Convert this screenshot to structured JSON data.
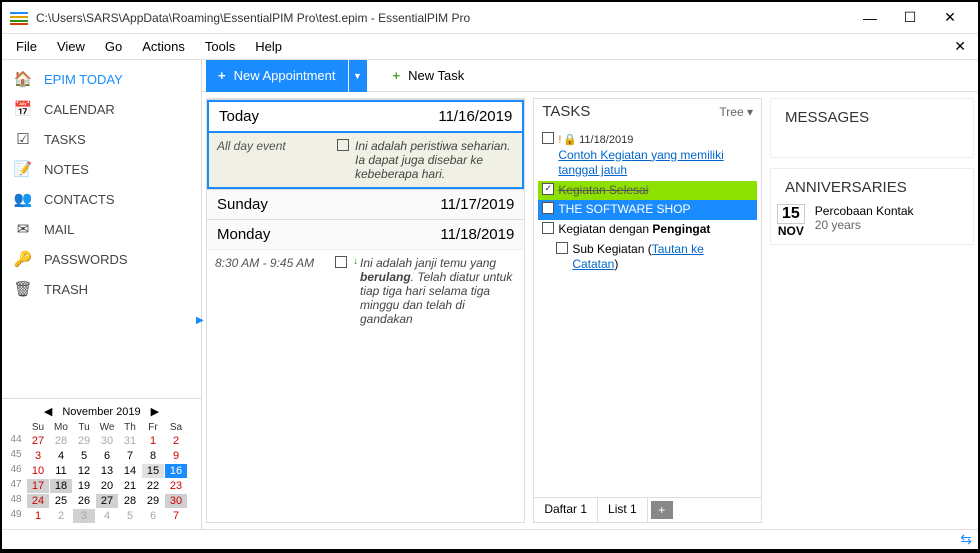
{
  "window": {
    "title": "C:\\Users\\SARS\\AppData\\Roaming\\EssentialPIM Pro\\test.epim - EssentialPIM Pro"
  },
  "menu": [
    "File",
    "View",
    "Go",
    "Actions",
    "Tools",
    "Help"
  ],
  "sidebar": {
    "items": [
      {
        "label": "EPIM TODAY",
        "icon": "🏠",
        "active": true
      },
      {
        "label": "CALENDAR",
        "icon": "📅"
      },
      {
        "label": "TASKS",
        "icon": "☑"
      },
      {
        "label": "NOTES",
        "icon": "📝"
      },
      {
        "label": "CONTACTS",
        "icon": "👥"
      },
      {
        "label": "MAIL",
        "icon": "✉"
      },
      {
        "label": "PASSWORDS",
        "icon": "🔑"
      },
      {
        "label": "TRASH",
        "icon": "🗑"
      }
    ],
    "calendar": {
      "title": "November  2019",
      "headers": [
        "",
        "Su",
        "Mo",
        "Tu",
        "We",
        "Th",
        "Fr",
        "Sa"
      ],
      "rows": [
        {
          "wk": "44",
          "days": [
            {
              "n": "27",
              "dim": 1,
              "red": 1
            },
            {
              "n": "28",
              "dim": 1
            },
            {
              "n": "29",
              "dim": 1
            },
            {
              "n": "30",
              "dim": 1
            },
            {
              "n": "31",
              "dim": 1
            },
            {
              "n": "1",
              "red": 1
            },
            {
              "n": "2",
              "red": 1
            }
          ]
        },
        {
          "wk": "45",
          "days": [
            {
              "n": "3",
              "red": 1
            },
            {
              "n": "4"
            },
            {
              "n": "5"
            },
            {
              "n": "6"
            },
            {
              "n": "7"
            },
            {
              "n": "8"
            },
            {
              "n": "9",
              "red": 1
            }
          ]
        },
        {
          "wk": "46",
          "days": [
            {
              "n": "10",
              "red": 1
            },
            {
              "n": "11"
            },
            {
              "n": "12"
            },
            {
              "n": "13"
            },
            {
              "n": "14"
            },
            {
              "n": "15",
              "sel": 1
            },
            {
              "n": "16",
              "today": 1
            }
          ]
        },
        {
          "wk": "47",
          "days": [
            {
              "n": "17",
              "red": 1,
              "hl": 1
            },
            {
              "n": "18",
              "hl": 1
            },
            {
              "n": "19"
            },
            {
              "n": "20"
            },
            {
              "n": "21"
            },
            {
              "n": "22"
            },
            {
              "n": "23",
              "red": 1
            }
          ]
        },
        {
          "wk": "48",
          "days": [
            {
              "n": "24",
              "red": 1,
              "hl": 1
            },
            {
              "n": "25"
            },
            {
              "n": "26"
            },
            {
              "n": "27",
              "hl": 1
            },
            {
              "n": "28"
            },
            {
              "n": "29"
            },
            {
              "n": "30",
              "red": 1,
              "hl": 1
            }
          ]
        },
        {
          "wk": "49",
          "days": [
            {
              "n": "1",
              "dim": 1,
              "red": 1
            },
            {
              "n": "2",
              "dim": 1
            },
            {
              "n": "3",
              "dim": 1,
              "hl": 1
            },
            {
              "n": "4",
              "dim": 1
            },
            {
              "n": "5",
              "dim": 1
            },
            {
              "n": "6",
              "dim": 1
            },
            {
              "n": "7",
              "dim": 1,
              "red": 1
            }
          ]
        }
      ]
    }
  },
  "toolbar": {
    "new_appt": "New Appointment",
    "new_task": "New Task"
  },
  "agenda": {
    "days": [
      {
        "name": "Today",
        "date": "11/16/2019",
        "selected": true,
        "events": [
          {
            "time": "All day event",
            "desc": "Ini adalah peristiwa seharian. Ia dapat juga disebar ke kebeberapa hari.",
            "allday": true
          }
        ]
      },
      {
        "name": "Sunday",
        "date": "11/17/2019",
        "events": []
      },
      {
        "name": "Monday",
        "date": "11/18/2019",
        "events": [
          {
            "time": "8:30 AM - 9:45 AM",
            "desc_html": "Ini adalah janji temu yang <b>berulang</b>. Telah diatur untuk tiap tiga hari selama tiga minggu dan telah di gandakan",
            "arrow": true
          }
        ]
      }
    ]
  },
  "tasks": {
    "title": "TASKS",
    "tree_label": "Tree ▾",
    "items": [
      {
        "date": "11/18/2019",
        "text": "Contoh Kegiatan yang memiliki tanggal jatuh",
        "ex": true,
        "lock": true,
        "link": true
      },
      {
        "text": "Kegiatan Selesai",
        "done": true
      },
      {
        "text": "THE SOFTWARE SHOP",
        "selected": true
      },
      {
        "text_html": "Kegiatan dengan <b>Pengingat</b>",
        "children": [
          {
            "text_html": "Sub Kegiatan (<span class='link'>Tautan ke Catatan</span>)"
          }
        ]
      }
    ],
    "tabs": [
      "Daftar 1",
      "List 1"
    ]
  },
  "messages": {
    "title": "MESSAGES"
  },
  "anniversaries": {
    "title": "ANNIVERSARIES",
    "items": [
      {
        "day": "15",
        "mon": "NOV",
        "name": "Percobaan Kontak",
        "age": "20 years"
      }
    ]
  }
}
